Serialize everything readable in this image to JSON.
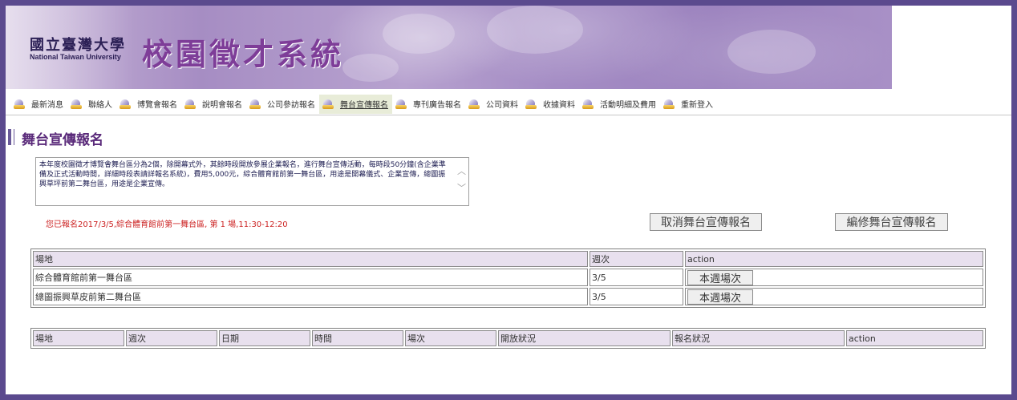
{
  "header": {
    "univ_cn": "國立臺灣大學",
    "univ_en": "National Taiwan University",
    "system_title": "校園徵才系統"
  },
  "nav": {
    "items": [
      {
        "label": "最新消息",
        "active": false
      },
      {
        "label": "聯絡人",
        "active": false
      },
      {
        "label": "博覽會報名",
        "active": false
      },
      {
        "label": "說明會報名",
        "active": false
      },
      {
        "label": "公司參訪報名",
        "active": false
      },
      {
        "label": "舞台宣傳報名",
        "active": true
      },
      {
        "label": "專刊廣告報名",
        "active": false
      },
      {
        "label": "公司資料",
        "active": false
      },
      {
        "label": "收據資料",
        "active": false
      },
      {
        "label": "活動明細及費用",
        "active": false
      },
      {
        "label": "重新登入",
        "active": false
      }
    ]
  },
  "page": {
    "title": "舞台宣傳報名",
    "notice": "本年度校園徵才博覽會舞台區分為2個，除開幕式外，其餘時段開放參展企業報名，進行舞台宣傳活動，每時段50分鐘(含企業準備及正式活動時間，詳細時段表請詳報名系統)，費用5,000元，綜合體育館前第一舞台區，用途是開幕儀式、企業宣傳，總圖振興草坪前第二舞台區，用途是企業宣傳。",
    "status": "您已報名2017/3/5,綜合體育館前第一舞台區, 第 1 場,11:30-12:20",
    "cancel_button": "取消舞台宣傳報名",
    "edit_button": "編修舞台宣傳報名"
  },
  "venue_table": {
    "headers": [
      "場地",
      "週次",
      "action"
    ],
    "rows": [
      {
        "venue": "綜合體育館前第一舞台區",
        "week": "3/5",
        "action": "本週場次"
      },
      {
        "venue": "總圖振興草皮前第二舞台區",
        "week": "3/5",
        "action": "本週場次"
      }
    ]
  },
  "schedule_table": {
    "headers": [
      "場地",
      "週次",
      "日期",
      "時間",
      "場次",
      "開放狀況",
      "報名狀況",
      "action"
    ]
  },
  "colors": {
    "frame": "#5b4a8e",
    "header_cell": "#e8e0ee",
    "status_text": "#cc2222",
    "title": "#5a2a7a"
  }
}
